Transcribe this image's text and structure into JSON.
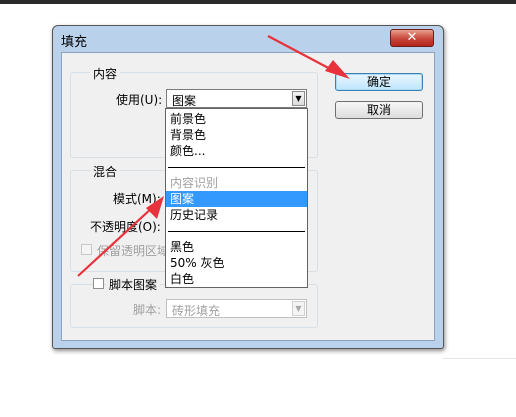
{
  "dialog": {
    "title": "填充",
    "close_glyph": "✕",
    "ok_label": "确定",
    "cancel_label": "取消"
  },
  "content_group": {
    "legend": "内容",
    "use_label": "使用(U):",
    "use_value": "图案"
  },
  "blend_group": {
    "legend": "混合",
    "mode_label": "模式(M):",
    "opacity_label": "不透明度(O):",
    "preserve_label": "保留透明区域"
  },
  "script_group": {
    "checkbox_label": "脚本图案",
    "script_label": "脚本:",
    "script_value": "砖形填充"
  },
  "dropdown": {
    "items": [
      {
        "label": "前景色",
        "state": "normal"
      },
      {
        "label": "背景色",
        "state": "normal"
      },
      {
        "label": "颜色...",
        "state": "normal"
      },
      {
        "label": "内容识别",
        "state": "disabled"
      },
      {
        "label": "图案",
        "state": "selected"
      },
      {
        "label": "历史记录",
        "state": "normal"
      },
      {
        "label": "黑色",
        "state": "normal"
      },
      {
        "label": "50% 灰色",
        "state": "normal"
      },
      {
        "label": "白色",
        "state": "normal"
      }
    ]
  },
  "colors": {
    "annotation_arrow": "#e8323c",
    "selection": "#3399ff",
    "window_frame": "#b9d1ea"
  },
  "icons": {
    "dropdown_arrow": "chevron-down-icon",
    "annotation": "red-arrow-icon"
  }
}
